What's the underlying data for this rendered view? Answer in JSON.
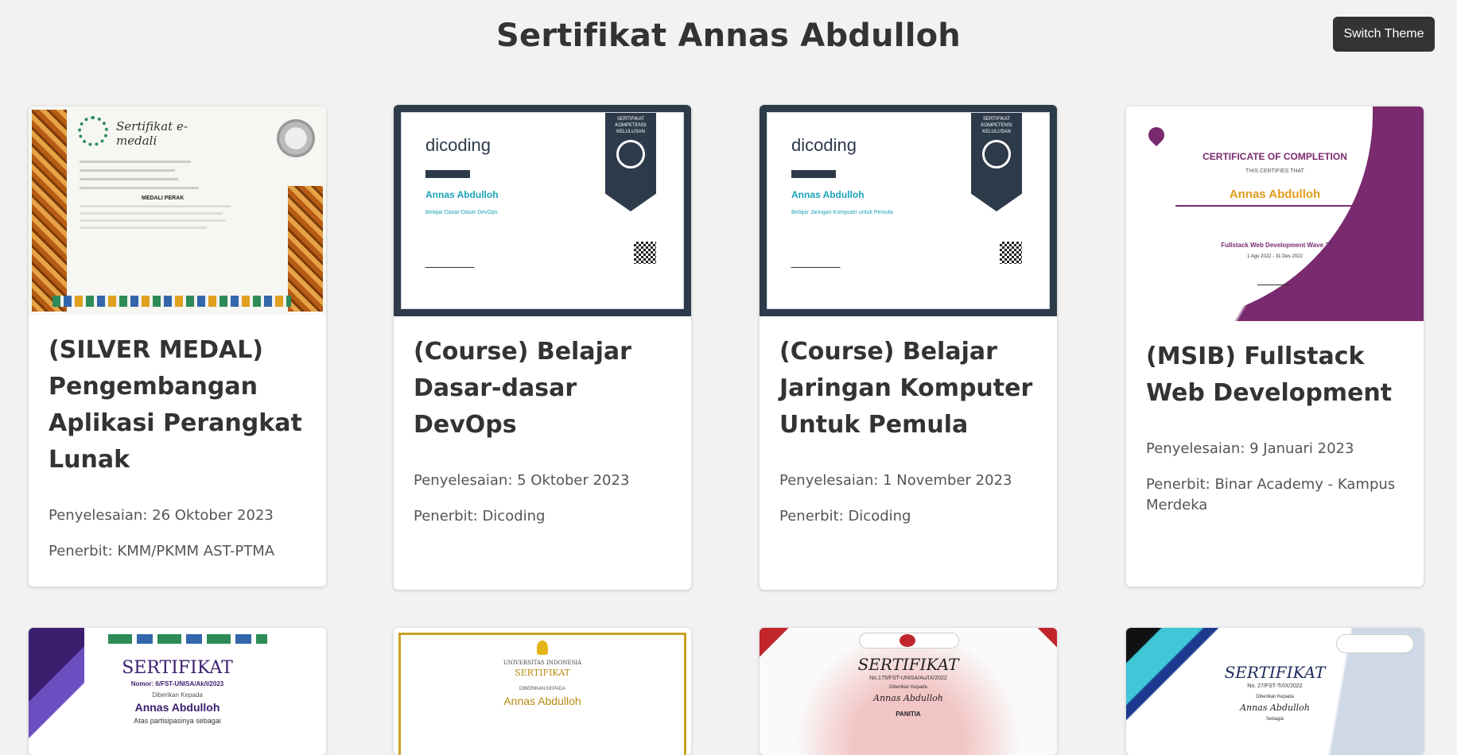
{
  "page": {
    "title": "Sertifikat Annas Abdulloh"
  },
  "toolbar": {
    "switch_theme_label": "Switch Theme"
  },
  "cards": [
    {
      "title": "(SILVER MEDAL) Pengembangan Aplikasi Perangkat Lunak",
      "completion": "Penyelesaian: 26 Oktober 2023",
      "issuer": "Penerbit: KMM/PKMM AST-PTMA",
      "thumb": {
        "heading": "Sertifikat e-medali",
        "award": "MEDALI PERAK"
      }
    },
    {
      "title": "(Course) Belajar Dasar-dasar DevOps",
      "completion": "Penyelesaian: 5 Oktober 2023",
      "issuer": "Penerbit: Dicoding",
      "thumb": {
        "logo": "dicoding",
        "badge": "SERTIFIKAT KOMPETENSI KELULUSAN",
        "name": "Annas Abdulloh",
        "course": "Belajar Dasar-Dasar DevOps"
      }
    },
    {
      "title": "(Course) Belajar Jaringan Komputer Untuk Pemula",
      "completion": "Penyelesaian: 1 November 2023",
      "issuer": "Penerbit: Dicoding",
      "thumb": {
        "logo": "dicoding",
        "badge": "SERTIFIKAT KOMPETENSI KELULUSAN",
        "name": "Annas Abdulloh",
        "course": "Belajar Jaringan Komputer untuk Pemula"
      }
    },
    {
      "title": "(MSIB) Fullstack Web Development",
      "completion": "Penyelesaian: 9 Januari 2023",
      "issuer": "Penerbit: Binar Academy - Kampus Merdeka",
      "thumb": {
        "heading": "CERTIFICATE OF COMPLETION",
        "sub": "THIS CERTIFIES THAT",
        "name": "Annas Abdulloh",
        "program": "Fullstack Web Development Wave 3",
        "dates": "1 Agu 2022 - 31 Des 2022"
      }
    }
  ],
  "row2": [
    {
      "heading": "SERTIFIKAT",
      "number": "Nomor: 6/FST-UNISA/Ak/I/2023",
      "given": "Diberikan Kepada",
      "name": "Annas Abdulloh",
      "note": "Atas partisipasinya sebagai"
    },
    {
      "univ": "UNIVERSITAS INDONESIA",
      "heading": "SERTIFIKAT",
      "given": "DIBERIKAN KEPADA",
      "name": "Annas Abdulloh"
    },
    {
      "heading": "SERTIFIKAT",
      "number": "No.175/FST-UNISA/Au/IX/2022",
      "given": "Diberikan Kepada",
      "name": "Annas Abdulloh",
      "role": "PANITIA"
    },
    {
      "heading": "SERTIFIKAT",
      "number": "No. 27/FST-Ti/IX/2022",
      "given": "Diberikan Kepada",
      "name": "Annas Abdulloh",
      "note": "Sebagai"
    }
  ],
  "colors": {
    "background": "#f2f2f2",
    "card": "#ffffff",
    "text": "#333333",
    "meta": "#555555",
    "button": "#333333",
    "dicoding_navy": "#2d3a4a",
    "binar_purple": "#7a2a6e"
  }
}
